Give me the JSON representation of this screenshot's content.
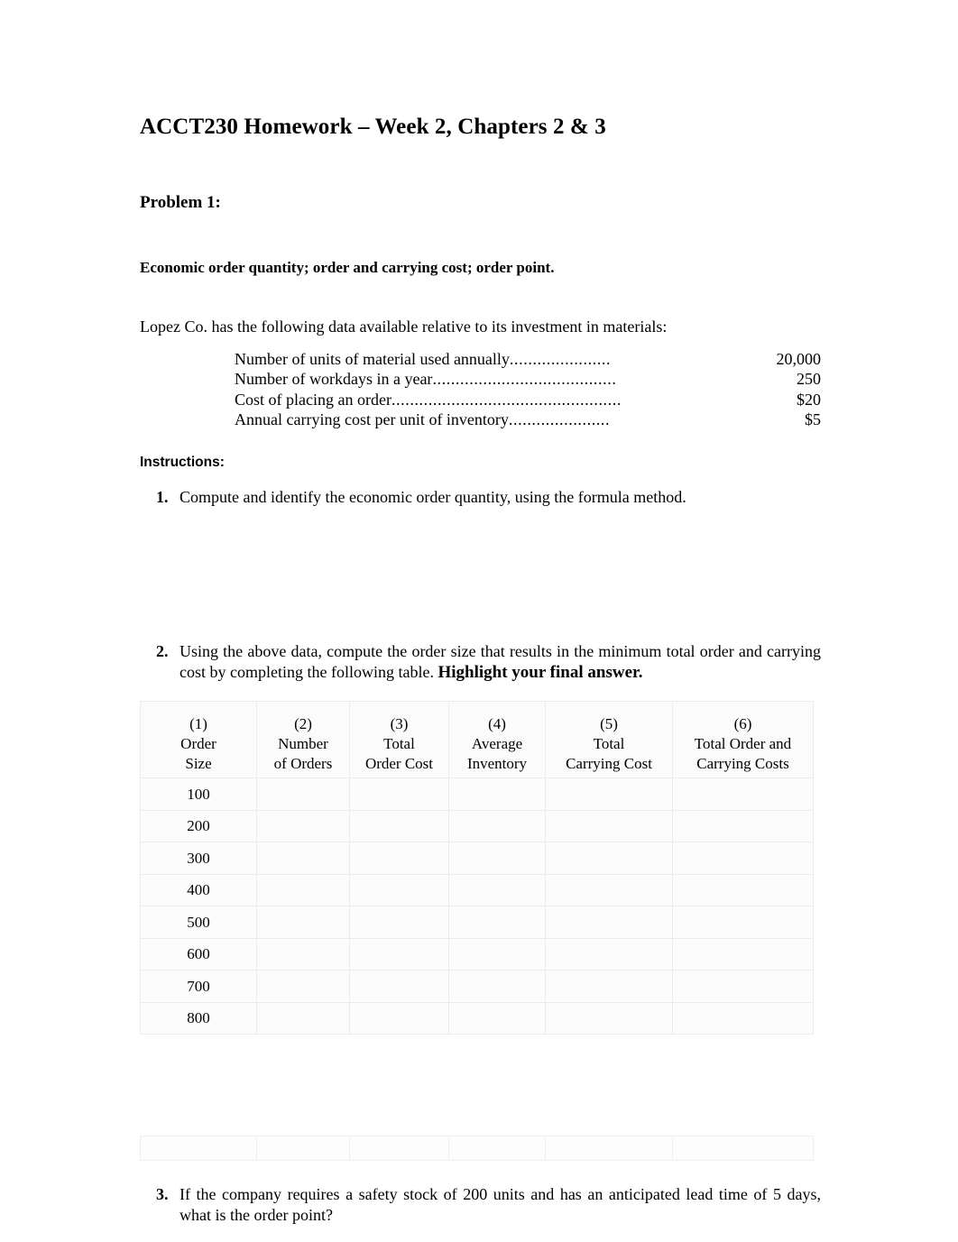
{
  "document": {
    "title": "ACCT230 Homework – Week 2, Chapters 2 & 3",
    "problem_heading": "Problem 1:",
    "topic": "Economic order quantity; order and carrying cost; order point.",
    "intro": "Lopez Co. has the following data available relative to its investment in materials:",
    "instructions_label": "Instructions:"
  },
  "data_list": [
    {
      "label": "Number of units of material used annually",
      "dots": "......................",
      "value": "20,000"
    },
    {
      "label": "Number of workdays in a year",
      "dots": "........................................",
      "value": "250"
    },
    {
      "label": "Cost of placing an order",
      "dots": "..................................................",
      "value": "$20"
    },
    {
      "label": "Annual carrying cost per unit of inventory",
      "dots": "......................",
      "value": "$5"
    }
  ],
  "instructions": [
    {
      "number": "1.",
      "text": "Compute and identify the economic order quantity, using the formula method."
    },
    {
      "number": "2.",
      "text": "Using the above data, compute the order size that results in the minimum total order and carrying cost by completing the following table. ",
      "emphasis": "Highlight your final answer."
    },
    {
      "number": "3.",
      "text": "If the company requires a safety stock of 200 units and has an anticipated lead time of 5 days, what is the order point?"
    }
  ],
  "calc_table": {
    "headers": [
      {
        "number": "(1)",
        "line1": "Order",
        "line2": "Size"
      },
      {
        "number": "(2)",
        "line1": "Number",
        "line2": "of Orders"
      },
      {
        "number": "(3)",
        "line1": "Total",
        "line2": "Order Cost"
      },
      {
        "number": "(4)",
        "line1": "Average",
        "line2": "Inventory"
      },
      {
        "number": "(5)",
        "line1": "Total",
        "line2": "Carrying Cost"
      },
      {
        "number": "(6)",
        "line1": "Total Order and",
        "line2": "Carrying Costs"
      }
    ],
    "rows": [
      {
        "order_size": "100",
        "number_of_orders": "",
        "total_order_cost": "",
        "average_inventory": "",
        "total_carrying_cost": "",
        "total_order_and_carrying_costs": ""
      },
      {
        "order_size": "200",
        "number_of_orders": "",
        "total_order_cost": "",
        "average_inventory": "",
        "total_carrying_cost": "",
        "total_order_and_carrying_costs": ""
      },
      {
        "order_size": "300",
        "number_of_orders": "",
        "total_order_cost": "",
        "average_inventory": "",
        "total_carrying_cost": "",
        "total_order_and_carrying_costs": ""
      },
      {
        "order_size": "400",
        "number_of_orders": "",
        "total_order_cost": "",
        "average_inventory": "",
        "total_carrying_cost": "",
        "total_order_and_carrying_costs": ""
      },
      {
        "order_size": "500",
        "number_of_orders": "",
        "total_order_cost": "",
        "average_inventory": "",
        "total_carrying_cost": "",
        "total_order_and_carrying_costs": ""
      },
      {
        "order_size": "600",
        "number_of_orders": "",
        "total_order_cost": "",
        "average_inventory": "",
        "total_carrying_cost": "",
        "total_order_and_carrying_costs": ""
      },
      {
        "order_size": "700",
        "number_of_orders": "",
        "total_order_cost": "",
        "average_inventory": "",
        "total_carrying_cost": "",
        "total_order_and_carrying_costs": ""
      },
      {
        "order_size": "800",
        "number_of_orders": "",
        "total_order_cost": "",
        "average_inventory": "",
        "total_carrying_cost": "",
        "total_order_and_carrying_costs": ""
      }
    ]
  },
  "colors": {
    "text": "#000000",
    "page_background": "#ffffff",
    "table_border": "#ececec",
    "table_cell_background": "#fcfcfc"
  }
}
